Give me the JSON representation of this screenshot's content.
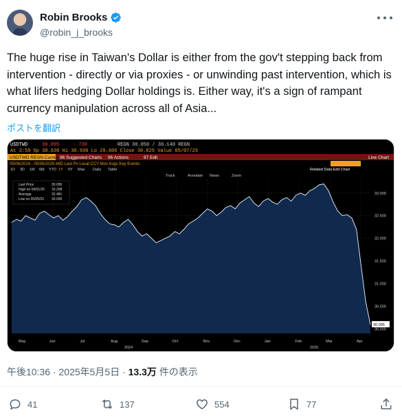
{
  "author": {
    "name": "Robin Brooks",
    "handle": "@robin_j_brooks"
  },
  "tweet": {
    "text": "The huge rise in Taiwan's Dollar is either from the gov't stepping back from intervention - directly or via proxies - or unwinding past intervention, which is what lifers hedging Dollar holdings is. Either way, it's a sign of rampant currency manipulation across all of Asia...",
    "translate_label": "ポストを翻訳"
  },
  "meta": {
    "time": "午後10:36",
    "sep1": "·",
    "date": "2025年5月5日",
    "sep2": "·",
    "views": "13.3万",
    "views_suffix": "件の表示"
  },
  "actions": {
    "replies": "41",
    "reposts": "137",
    "likes": "554",
    "bookmarks": "77"
  },
  "terminal": {
    "row1": {
      "ticker": "USDTWD",
      "price": "30.095",
      "change": "-.730",
      "regn": "REGN 30.050 / 30.140 REGN"
    },
    "row2": "At 3:59   Op 30.930   Hi 30.930   Lo 29.606   Close 30.825   Value 05/07/25",
    "row3_left": "USDTWD REGN Curncy",
    "row3_mid": "96 Suggested Charts",
    "row3_actions": "96 Actions",
    "row3_edit": "97 Edit",
    "row3_right": "Line Chart",
    "row4": "05/06/2024 - 05/05/2025   MID   Last Px   Local CCY   Mov Avgs   Key Events",
    "row5_periods": [
      "1D",
      "3D",
      "1M",
      "6M",
      "YTD",
      "1Y",
      "5Y",
      "Max",
      "Daily",
      "Table"
    ],
    "row5_right": "Related Data   Edit Chart",
    "toolbar": [
      "Track",
      "Annotate",
      "News",
      "Zoom"
    ],
    "legend": [
      {
        "label": "Last Price",
        "value": "30.095"
      },
      {
        "label": "High on 04/01/25",
        "value": "33.208"
      },
      {
        "label": "Average",
        "value": "32.481"
      },
      {
        "label": "Low on 05/05/25",
        "value": "30.095"
      }
    ],
    "last_tag": "30.095",
    "year_labels": [
      "2024",
      "2025"
    ]
  },
  "chart_data": {
    "type": "area",
    "ylim": [
      29.9,
      33.3
    ],
    "y_ticks": [
      "33.000",
      "32.500",
      "32.000",
      "31.500",
      "31.000",
      "30.500",
      "30.000"
    ],
    "x_ticks": [
      "May",
      "Jun",
      "Jul",
      "Aug",
      "Sep",
      "Oct",
      "Nov",
      "Dec",
      "Jan",
      "Feb",
      "Mar",
      "Apr"
    ],
    "series": [
      {
        "values": [
          32.35,
          32.42,
          32.38,
          32.5,
          32.45,
          32.4,
          32.55,
          32.6,
          32.52,
          32.45,
          32.5,
          32.4,
          32.48,
          32.6,
          32.7,
          32.85,
          32.9,
          32.82,
          32.72,
          32.55,
          32.42,
          32.32,
          32.3,
          32.25,
          32.35,
          32.42,
          32.3,
          32.15,
          32.05,
          32.1,
          32.0,
          31.9,
          31.95,
          32.0,
          32.05,
          32.15,
          32.1,
          32.2,
          32.32,
          32.38,
          32.45,
          32.55,
          32.65,
          32.6,
          32.5,
          32.58,
          32.68,
          32.72,
          32.65,
          32.78,
          32.85,
          32.92,
          32.78,
          32.7,
          32.82,
          32.88,
          32.8,
          32.75,
          32.85,
          32.9,
          32.82,
          32.95,
          33.0,
          32.95,
          33.05,
          33.1,
          33.18,
          33.2,
          33.05,
          32.8,
          32.6,
          32.5,
          32.52,
          32.45,
          32.2,
          31.4,
          30.6,
          30.095
        ]
      }
    ]
  }
}
